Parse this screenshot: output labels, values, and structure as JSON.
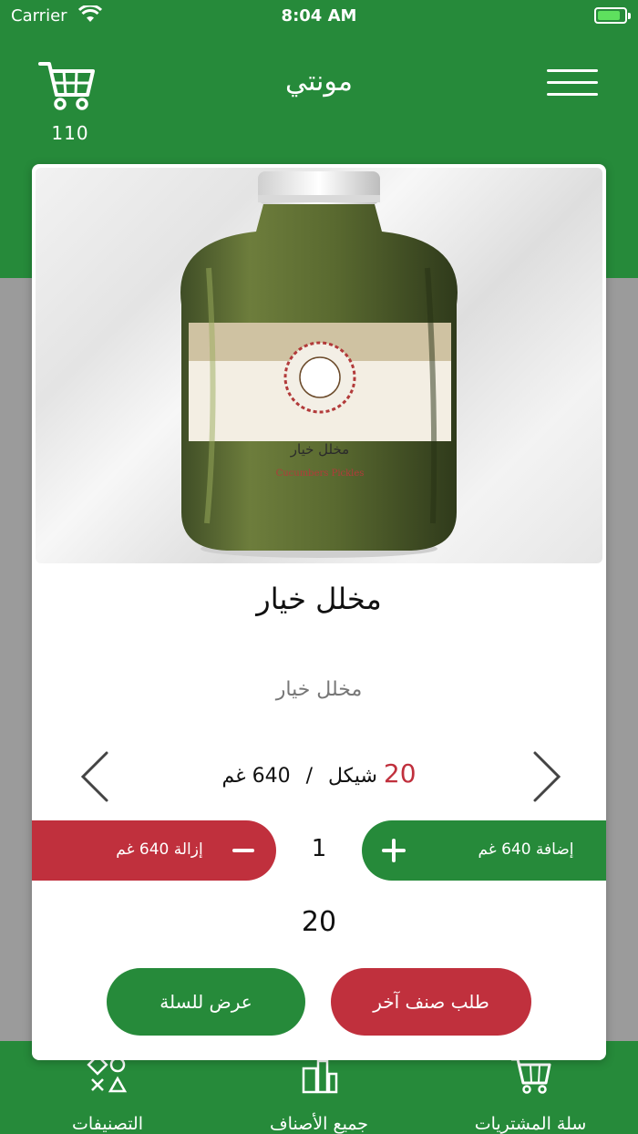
{
  "status_bar": {
    "carrier": "Carrier",
    "time": "8:04 AM"
  },
  "header": {
    "title": "مونتي",
    "cart_count": "110"
  },
  "product": {
    "name": "مخلل خيار",
    "description": "مخلل خيار",
    "jar_label_ar": "مخلل خيار",
    "jar_label_en": "Cucumbers Pickles",
    "price": "20",
    "currency": "شيكل",
    "separator": "/",
    "unit": "640 غم",
    "quantity": "1",
    "total": "20"
  },
  "actions": {
    "add_label": "إضافة 640 غم",
    "remove_label": "إزالة 640 غم",
    "view_cart_label": "عرض للسلة",
    "order_other_label": "طلب صنف آخر"
  },
  "tabs": [
    {
      "label": "التصنيفات",
      "icon": "categories-icon"
    },
    {
      "label": "جميع الأصناف",
      "icon": "all-items-icon"
    },
    {
      "label": "سلة المشتريات",
      "icon": "cart-icon"
    }
  ],
  "colors": {
    "primary_green": "#268a3a",
    "accent_red": "#c0303d"
  }
}
